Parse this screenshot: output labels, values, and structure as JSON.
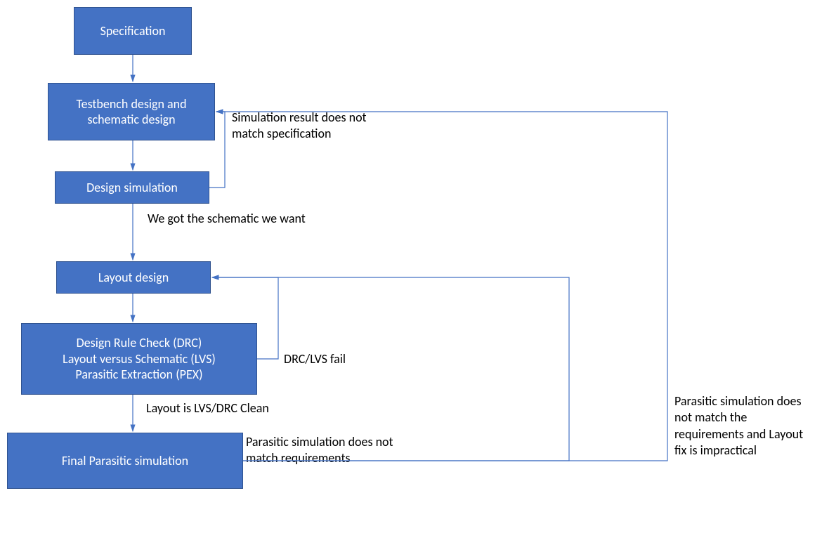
{
  "boxes": {
    "spec": "Specification",
    "testbench": "Testbench design and schematic design",
    "designSim": "Design simulation",
    "layoutDesign": "Layout design",
    "drc": "Design Rule Check (DRC)\nLayout versus Schematic (LVS)\nParasitic Extraction (PEX)",
    "finalSim": "Final Parasitic simulation"
  },
  "labels": {
    "simNoMatch": "Simulation result does not match specification",
    "gotSchematic": "We got the schematic we want",
    "drcFail": "DRC/LVS fail",
    "layoutClean": "Layout is LVS/DRC Clean",
    "parasiticNoMatch": "Parasitic simulation does not match requirements",
    "parasiticImpractical": "Parasitic simulation does not match the requirements and Layout fix is impractical"
  }
}
